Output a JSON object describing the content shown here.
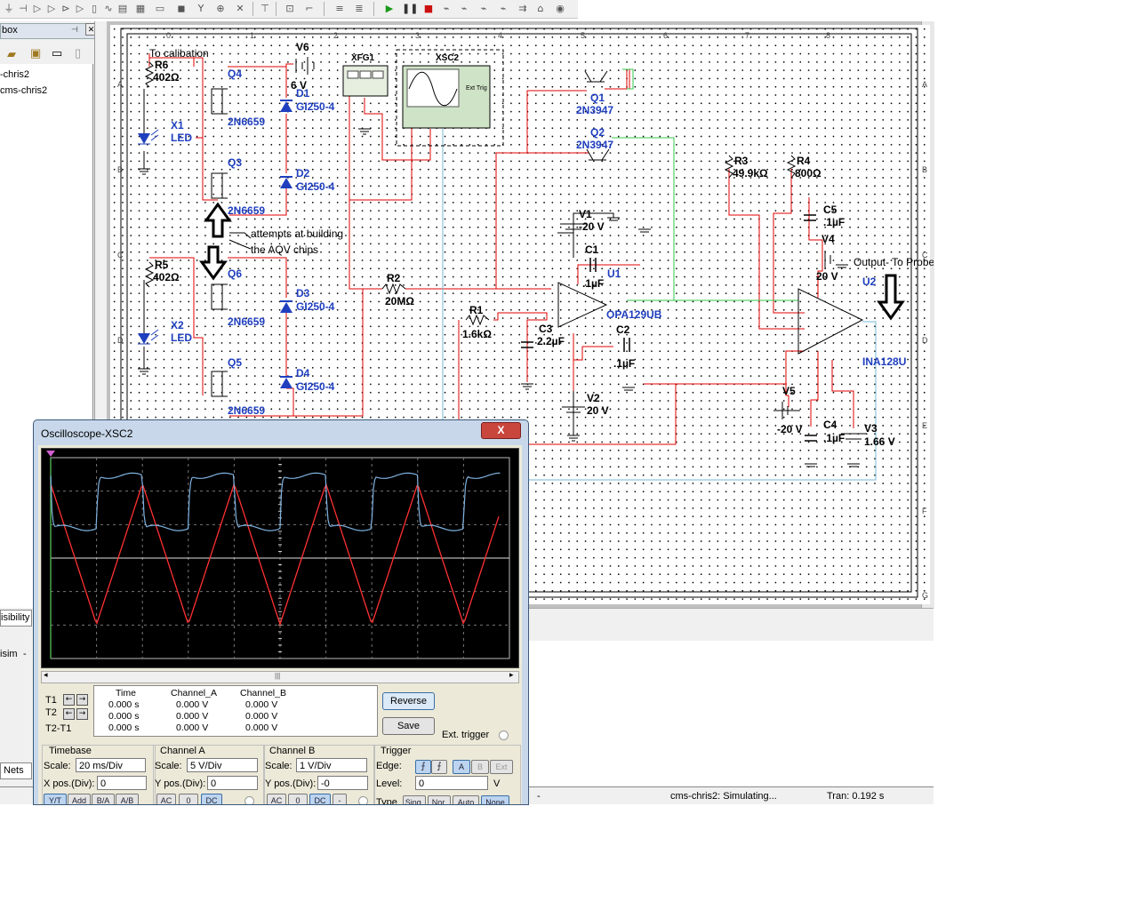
{
  "left_panel": {
    "header": "box",
    "items": [
      "-chris2",
      "cms-chris2"
    ],
    "visibility_tab": "isibility",
    "sim_tab": "isim",
    "nets_tab": "Nets"
  },
  "schematic": {
    "ruler_numbers": [
      "0",
      "1",
      "2",
      "3",
      "4",
      "5",
      "6",
      "7",
      "8"
    ],
    "ruler_letters": [
      "A",
      "B",
      "C",
      "D",
      "E",
      "F",
      "G"
    ],
    "labels": {
      "to_calibation": "To calibation",
      "r6": "R6",
      "r6v": "402Ω",
      "r5": "R5",
      "r5v": "402Ω",
      "x1": "X1",
      "x1t": "LED",
      "x2": "X2",
      "x2t": "LED",
      "q4": "Q4",
      "q3": "Q3",
      "q6": "Q6",
      "q5": "Q5",
      "mos": "2N6659",
      "v6": "V6",
      "v6v": "6 V",
      "d1": "D1",
      "d2": "D2",
      "d3": "D3",
      "d4": "D4",
      "gi": "GI250-4",
      "xfg1": "XFG1",
      "xsc2": "XSC2",
      "exttrig": "Ext Trig",
      "q1": "Q1",
      "q2": "Q2",
      "bjt": "2N3947",
      "annotation1": "attempts at  building",
      "annotation2": "the AQV chips",
      "r2": "R2",
      "r2v": "20MΩ",
      "r1": "R1",
      "r1v": "1.6kΩ",
      "c3": "C3",
      "c3v": "2.2µF",
      "v1": "V1",
      "v1v": "-20 V",
      "c1": "C1",
      "c1v": ".1µF",
      "u1": "U1",
      "u1t": "OPA129UB",
      "c2": "C2",
      "c2v": ".1µF",
      "v2": "V2",
      "v2v": "20 V",
      "r3": "R3",
      "r3v": "49.9kΩ",
      "r4": "R4",
      "r4v": "800Ω",
      "c5": "C5",
      "c5v": ".1µF",
      "v4": "V4",
      "v4v": "20 V",
      "output": "Output- To Probe",
      "u2": "U2",
      "u2t": "INA128U",
      "v5": "V5",
      "v5v": "-20 V",
      "c4": "C4",
      "c4v": ".1µF",
      "v3": "V3",
      "v3v": "1.66 V"
    }
  },
  "status_bar": {
    "dash": "-",
    "simulating": "cms-chris2: Simulating...",
    "tran": "Tran: 0.192 s"
  },
  "oscilloscope": {
    "title": "Oscilloscope-XSC2",
    "close_label": "X",
    "readout": {
      "headers": [
        "Time",
        "Channel_A",
        "Channel_B"
      ],
      "rows": [
        {
          "label": "T1",
          "time": "0.000 s",
          "a": "0.000 V",
          "b": "0.000 V"
        },
        {
          "label": "T2",
          "time": "0.000 s",
          "a": "0.000 V",
          "b": "0.000 V"
        },
        {
          "label": "T2-T1",
          "time": "0.000 s",
          "a": "0.000 V",
          "b": "0.000 V"
        }
      ]
    },
    "reverse_label": "Reverse",
    "save_label": "Save",
    "ext_trigger_label": "Ext. trigger",
    "timebase": {
      "title": "Timebase",
      "scale_label": "Scale:",
      "scale": "20 ms/Div",
      "xpos_label": "X pos.(Div):",
      "xpos": "0",
      "buttons": [
        "Y/T",
        "Add",
        "B/A",
        "A/B"
      ]
    },
    "channel_a": {
      "title": "Channel A",
      "scale_label": "Scale:",
      "scale": "5  V/Div",
      "ypos_label": "Y pos.(Div):",
      "ypos": "0",
      "buttons": [
        "AC",
        "0",
        "DC"
      ]
    },
    "channel_b": {
      "title": "Channel B",
      "scale_label": "Scale:",
      "scale": "1  V/Div",
      "ypos_label": "Y pos.(Div):",
      "ypos": "-0",
      "buttons": [
        "AC",
        "0",
        "DC",
        "-"
      ]
    },
    "trigger": {
      "title": "Trigger",
      "edge_label": "Edge:",
      "level_label": "Level:",
      "level": "0",
      "level_unit": "V",
      "source_buttons": [
        "A",
        "B",
        "Ext"
      ],
      "type_label": "Type",
      "type_buttons": [
        "Sing.",
        "Nor.",
        "Auto",
        "None"
      ]
    },
    "colors": {
      "channel_a": "#ff3030",
      "channel_b": "#7fb2e0"
    },
    "display": {
      "h_divisions": 10,
      "v_divisions": 6
    }
  }
}
